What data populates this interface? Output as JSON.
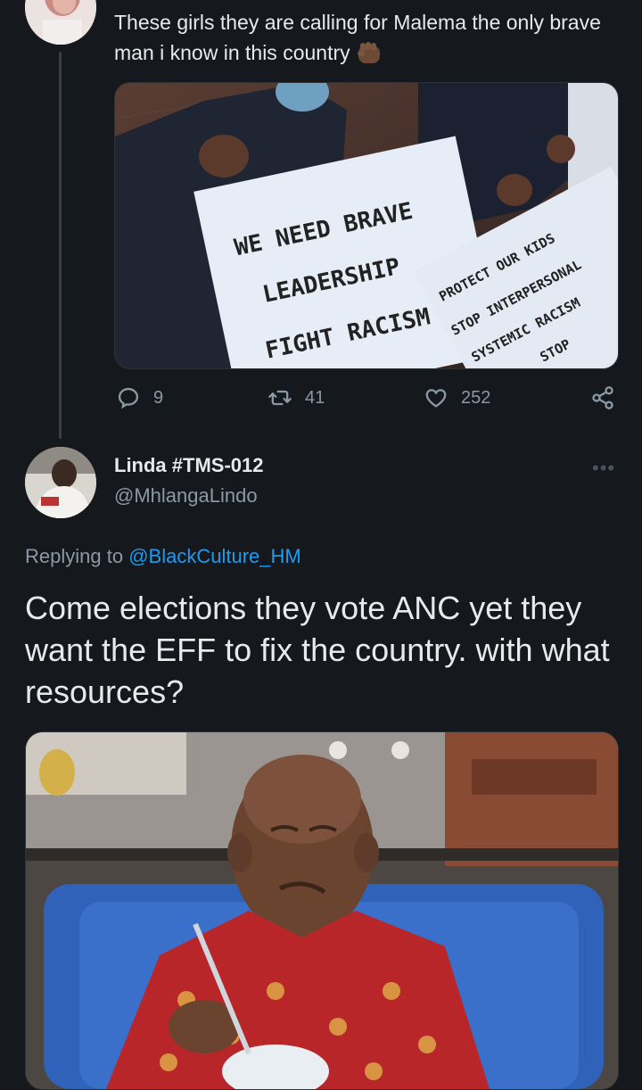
{
  "top_tweet": {
    "text": "These girls they are calling for Malema the only brave man i know in this country",
    "emoji": "raised-fist-emoji",
    "image": {
      "sign_1": [
        "WE NEED BRAVE",
        "LEADERSHIP",
        "FIGHT RACISM"
      ],
      "sign_2": [
        "PROTECT OUR KIDS",
        "STOP INTERPERSONAL",
        "SYSTEMIC RACISM",
        "STOP"
      ]
    },
    "actions": {
      "replies": "9",
      "retweets": "41",
      "likes": "252"
    }
  },
  "reply_tweet": {
    "author_name": "Linda #TMS-012",
    "author_handle": "@MhlangaLindo",
    "replying_prefix": "Replying to",
    "replying_to": "@BlackCulture_HM",
    "text": "Come elections they vote ANC yet they want the EFF to fix the country. with what resources?"
  },
  "colors": {
    "background": "#15181c",
    "text": "#e7e9ea",
    "secondary": "#8b98a5",
    "link": "#1d9bf0"
  }
}
